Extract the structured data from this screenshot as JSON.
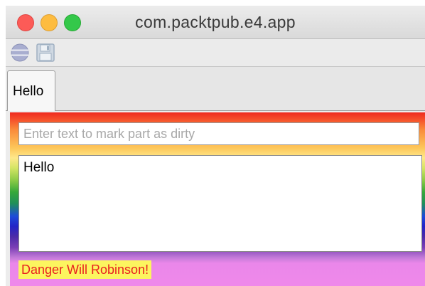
{
  "window": {
    "title": "com.packtpub.e4.app"
  },
  "toolbar": {
    "items": [
      {
        "icon": "sync-icon",
        "enabled": false
      },
      {
        "icon": "save-icon",
        "enabled": false
      }
    ]
  },
  "tabs": [
    {
      "label": "Hello",
      "active": true
    }
  ],
  "part": {
    "input_value": "",
    "input_placeholder": "Enter text to mark part as dirty",
    "text_area_value": "Hello",
    "warning_label": "Danger Will Robinson!",
    "colors": {
      "warning_background": "#fcf55f",
      "warning_text": "#e8201f",
      "background_gradient": [
        "#ef2a1f",
        "#fdc75a",
        "#36a83a",
        "#1d4bd9",
        "#7b3fb6",
        "#ef88ea"
      ]
    }
  }
}
